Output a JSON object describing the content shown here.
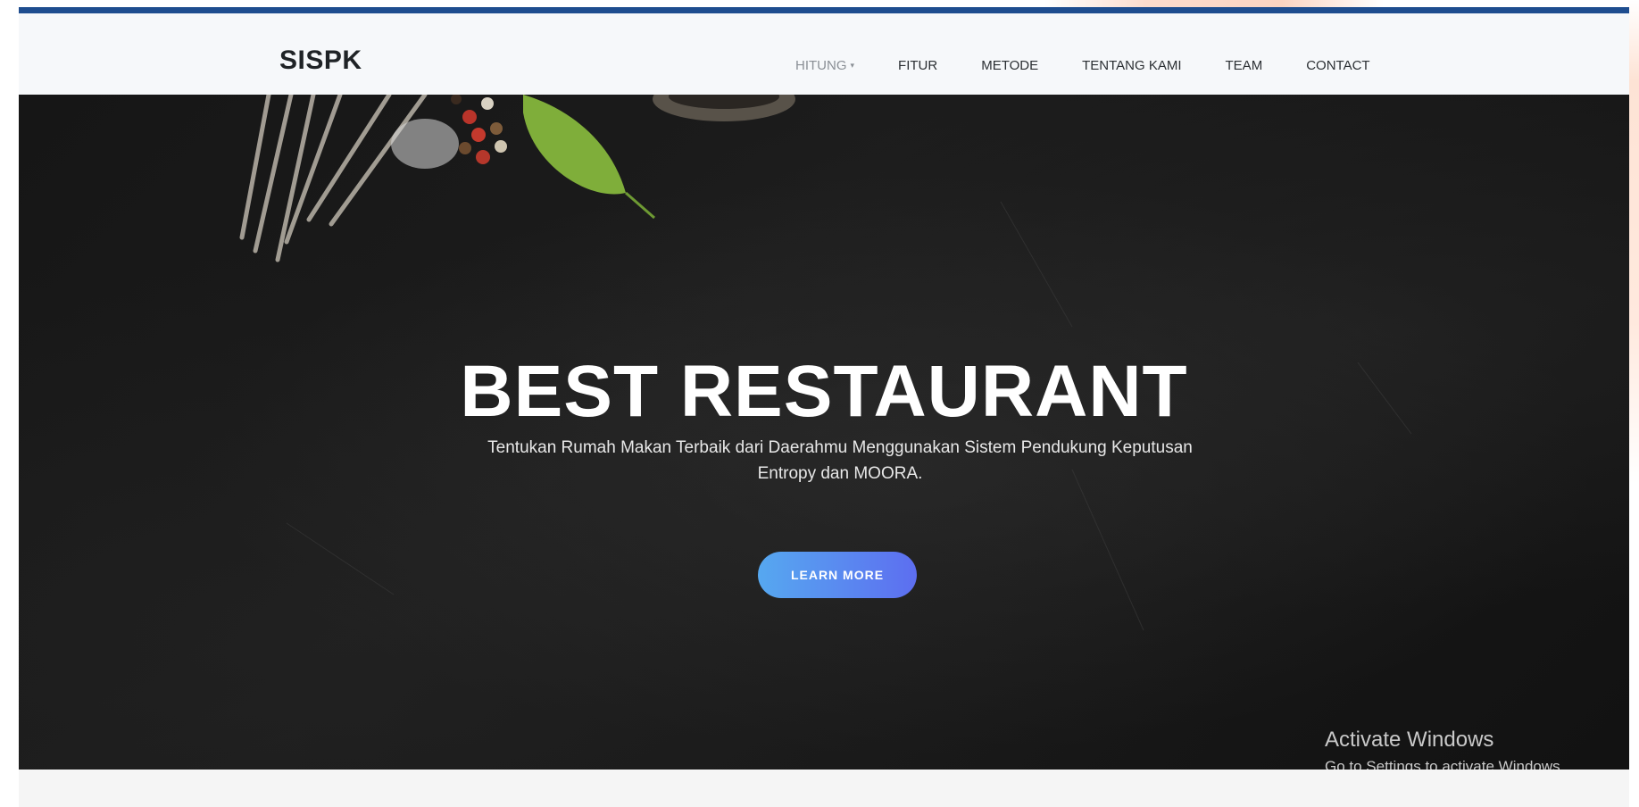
{
  "navbar": {
    "brand": "SISPK",
    "items": [
      {
        "label": "HITUNG",
        "has_caret": true
      },
      {
        "label": "FITUR"
      },
      {
        "label": "METODE"
      },
      {
        "label": "TENTANG KAMI"
      },
      {
        "label": "TEAM"
      },
      {
        "label": "CONTACT"
      }
    ],
    "caret_glyph": "▾"
  },
  "hero": {
    "title": "BEST RESTAURANT",
    "subtitle_line1": "Tentukan Rumah Makan Terbaik dari Daerahmu Menggunakan Sistem Pendukung Keputusan",
    "subtitle_line2": "Entropy dan MOORA.",
    "button_label": "LEARN MORE"
  },
  "watermark": {
    "line1": "Activate Windows",
    "line2": "Go to Settings to activate Windows."
  },
  "colors": {
    "top_accent": "#1e4d8f",
    "navbar_bg": "#f6f8fa",
    "button_gradient_start": "#56a8f0",
    "button_gradient_end": "#5d6ef0"
  }
}
